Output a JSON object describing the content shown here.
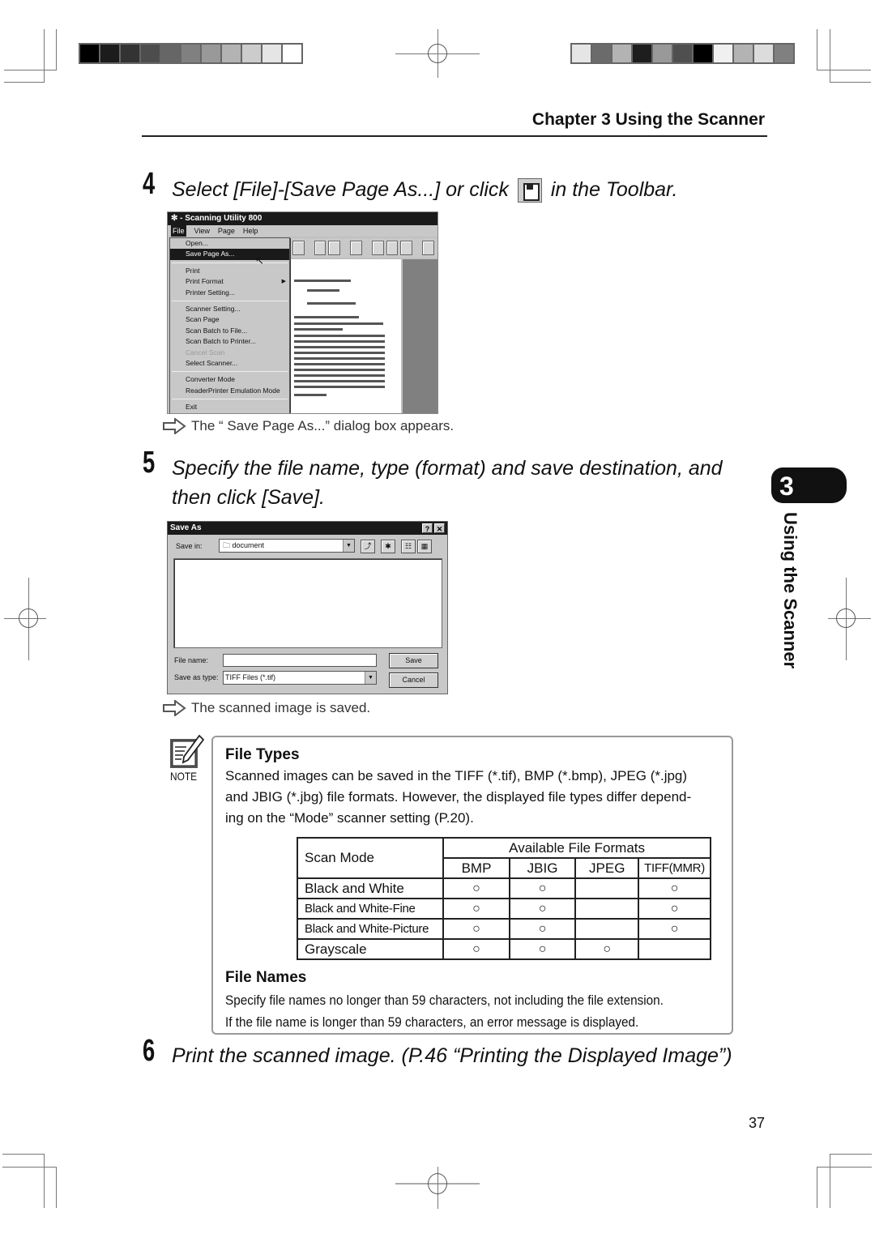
{
  "header": {
    "chapter_title": "Chapter 3 Using the Scanner"
  },
  "colorbars": {
    "left": [
      "#000000",
      "#1c1c1c",
      "#333333",
      "#4d4d4d",
      "#666666",
      "#808080",
      "#999999",
      "#b3b3b3",
      "#cccccc",
      "#e5e5e5",
      "#ffffff"
    ],
    "right": [
      "#e5e5e5",
      "#6b6b6b",
      "#b3b3b3",
      "#1e1e1e",
      "#999999",
      "#4f4f4f",
      "#000000",
      "#f0f0f0",
      "#b3b3b3",
      "#dcdcdc",
      "#808080"
    ]
  },
  "steps": [
    {
      "number": "4",
      "text_before_icon": "Select [File]-[Save Page As...] or click",
      "icon": "floppy-save-icon",
      "text_after_icon": "in the Toolbar.",
      "result": "The “ Save Page As...” dialog box appears."
    },
    {
      "number": "5",
      "text_line1": "Specify the file name, type (format) and save destination, and",
      "text_line2": "then click [Save].",
      "result": "The scanned image is saved."
    },
    {
      "number": "6",
      "text": "Print the scanned image. (P.46 “Printing the Displayed Image”)"
    }
  ],
  "scanning_utility": {
    "title": "- Scanning Utility 800",
    "menus": [
      "File",
      "View",
      "Page",
      "Help"
    ],
    "file_menu": {
      "groups": [
        [
          {
            "label": "Open...",
            "highlighted": false,
            "disabled": false
          },
          {
            "label": "Save Page As...",
            "highlighted": true,
            "disabled": false
          }
        ],
        [
          {
            "label": "Print",
            "highlighted": false,
            "disabled": false
          },
          {
            "label": "Print Format",
            "highlighted": false,
            "disabled": false,
            "submenu": true
          },
          {
            "label": "Printer Setting...",
            "highlighted": false,
            "disabled": false
          }
        ],
        [
          {
            "label": "Scanner Setting...",
            "highlighted": false,
            "disabled": false
          },
          {
            "label": "Scan Page",
            "highlighted": false,
            "disabled": false
          },
          {
            "label": "Scan Batch to File...",
            "highlighted": false,
            "disabled": false
          },
          {
            "label": "Scan Batch to Printer...",
            "highlighted": false,
            "disabled": false
          },
          {
            "label": "Cancel Scan",
            "highlighted": false,
            "disabled": true
          },
          {
            "label": "Select Scanner...",
            "highlighted": false,
            "disabled": false
          }
        ],
        [
          {
            "label": "Converter Mode",
            "highlighted": false,
            "disabled": false
          },
          {
            "label": "ReaderPrinter Emulation Mode",
            "highlighted": false,
            "disabled": false
          }
        ],
        [
          {
            "label": "Exit",
            "highlighted": false,
            "disabled": false
          }
        ]
      ]
    }
  },
  "save_as_dialog": {
    "title": "Save As",
    "help_button": "?",
    "close_button": "✕",
    "save_in_label": "Save in:",
    "save_in_value": "document",
    "file_name_label": "File name:",
    "file_name_value": "",
    "save_as_type_label": "Save as type:",
    "save_as_type_value": "TIFF Files (*.tif)",
    "save_button": "Save",
    "cancel_button": "Cancel"
  },
  "note": {
    "label": "NOTE",
    "file_types": {
      "heading": "File Types",
      "body_line1": "Scanned images can be saved in the TIFF (*.tif), BMP (*.bmp), JPEG (*.jpg)",
      "body_line2": "and JBIG (*.jbg) file formats. However, the displayed file types differ depend-",
      "body_line3": "ing on the “Mode” scanner setting (P.20)."
    },
    "table": {
      "row_header": "Scan Mode",
      "group_header": "Available File Formats",
      "columns": [
        "BMP",
        "JBIG",
        "JPEG",
        "TIFF(MMR)"
      ],
      "mark": "○",
      "rows": [
        {
          "mode": "Black and White",
          "marks": [
            "○",
            "○",
            "",
            "○"
          ]
        },
        {
          "mode": "Black and White-Fine",
          "marks": [
            "○",
            "○",
            "",
            "○"
          ]
        },
        {
          "mode": "Black and White-Picture",
          "marks": [
            "○",
            "○",
            "",
            "○"
          ]
        },
        {
          "mode": "Grayscale",
          "marks": [
            "○",
            "○",
            "○",
            ""
          ]
        }
      ]
    },
    "file_names": {
      "heading": "File Names",
      "body_line1": "Specify file names no longer than 59 characters, not including the file extension.",
      "body_line2": "If the file name is longer than 59 characters, an error message is displayed."
    }
  },
  "side_tab": {
    "number": "3",
    "label": "Using the Scanner"
  },
  "page_number": "37"
}
